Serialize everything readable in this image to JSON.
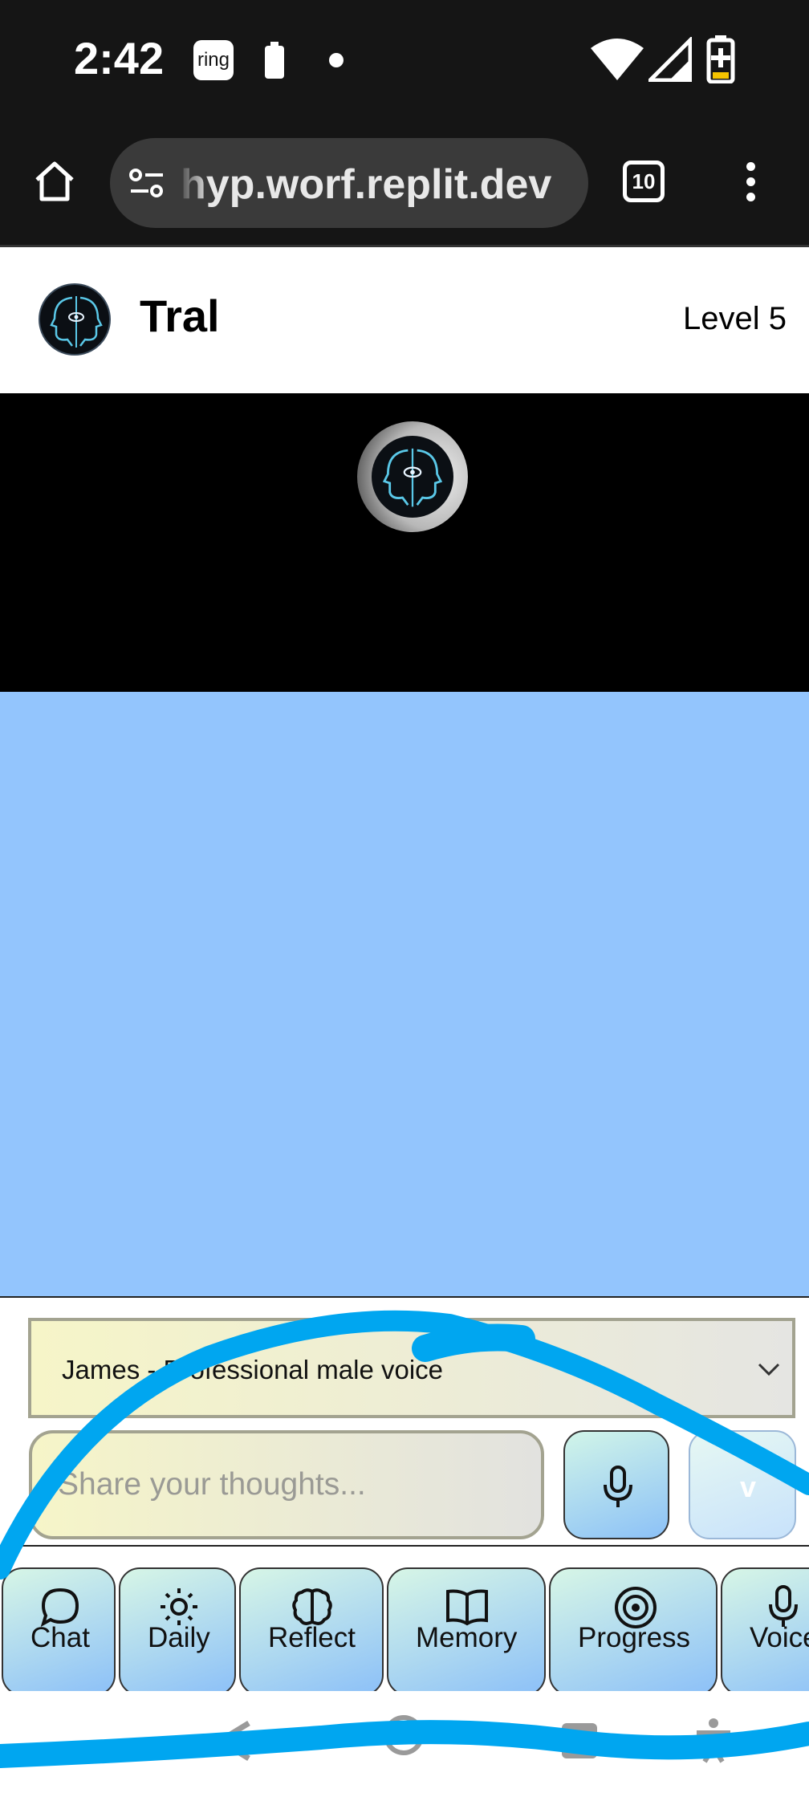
{
  "status_bar": {
    "time": "2:42",
    "ring_app_label": "ring"
  },
  "browser": {
    "url": "hyp.worf.replit.dev",
    "tab_count": "10"
  },
  "app_header": {
    "title": "Tral",
    "level": "Level 5"
  },
  "controls": {
    "voice_selected": "James - Professional male voice",
    "input_placeholder": "Share your thoughts...",
    "send_label": "v"
  },
  "nav": {
    "items": [
      {
        "label": "Chat",
        "icon": "chat-bubble-icon"
      },
      {
        "label": "Daily",
        "icon": "sun-icon"
      },
      {
        "label": "Reflect",
        "icon": "brain-icon"
      },
      {
        "label": "Memory",
        "icon": "book-icon"
      },
      {
        "label": "Progress",
        "icon": "target-icon"
      },
      {
        "label": "Voice",
        "icon": "mic-icon"
      }
    ]
  },
  "colors": {
    "chat_background": "#93c5fd",
    "scribble": "#00a6f0"
  }
}
